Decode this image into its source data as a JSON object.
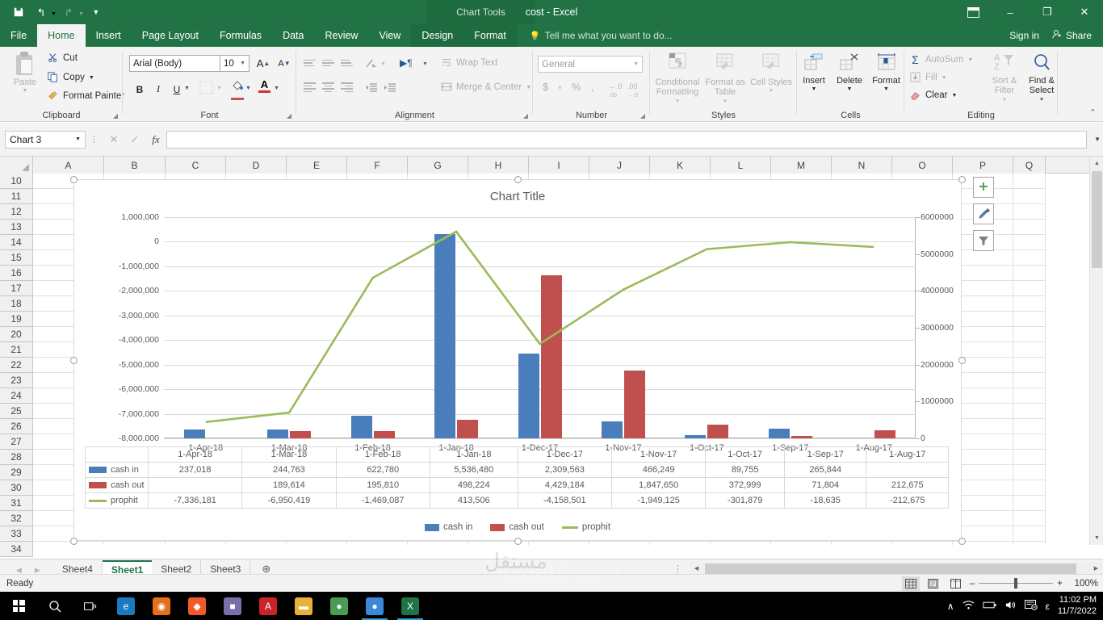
{
  "titlebar": {
    "document_title": "cost - Excel",
    "context_tools": "Chart Tools",
    "save_icon": "save-icon",
    "undo_icon": "undo-icon",
    "redo_icon": "redo-icon",
    "customize_icon": "customize-qat-icon",
    "ribbon_display_icon": "ribbon-display-options-icon",
    "minimize_label": "–",
    "maximize_label": "❐",
    "close_label": "✕"
  },
  "tabs": [
    {
      "label": "File",
      "active": false
    },
    {
      "label": "Home",
      "active": true
    },
    {
      "label": "Insert",
      "active": false
    },
    {
      "label": "Page Layout",
      "active": false
    },
    {
      "label": "Formulas",
      "active": false
    },
    {
      "label": "Data",
      "active": false
    },
    {
      "label": "Review",
      "active": false
    },
    {
      "label": "View",
      "active": false
    }
  ],
  "context_tabs": [
    {
      "label": "Design"
    },
    {
      "label": "Format"
    }
  ],
  "tellme": {
    "placeholder": "Tell me what you want to do...",
    "icon": "lightbulb-icon"
  },
  "account": {
    "sign_in": "Sign in",
    "share": "Share",
    "share_icon": "share-person-icon"
  },
  "ribbon": {
    "groups": [
      "Clipboard",
      "Font",
      "Alignment",
      "Number",
      "Styles",
      "Cells",
      "Editing"
    ],
    "clipboard": {
      "paste": "Paste",
      "cut": "Cut",
      "copy": "Copy",
      "format_painter": "Format Painter"
    },
    "font": {
      "font_name": "Arial (Body)",
      "font_size": "10",
      "grow_font": "A",
      "shrink_font": "A",
      "bold": "B",
      "italic": "I",
      "underline": "U"
    },
    "alignment": {
      "wrap_text": "Wrap Text",
      "merge_center": "Merge & Center"
    },
    "number": {
      "format": "General",
      "currency": "$",
      "percent": "%",
      "comma": ",",
      "increase_decimal": ".00",
      "decrease_decimal": ".00"
    },
    "styles": {
      "conditional_formatting": "Conditional Formatting",
      "format_as_table": "Format as Table",
      "cell_styles": "Cell Styles"
    },
    "cells": {
      "insert": "Insert",
      "delete": "Delete",
      "format": "Format"
    },
    "editing": {
      "autosum": "AutoSum",
      "fill": "Fill",
      "clear": "Clear",
      "sort_filter": "Sort & Filter",
      "find_select": "Find & Select"
    }
  },
  "formulabar": {
    "name_box": "Chart 3",
    "cancel_icon": "cancel-icon",
    "enter_icon": "enter-check-icon",
    "function_icon": "insert-function-icon",
    "formula_value": ""
  },
  "grid": {
    "columns": [
      "A",
      "B",
      "C",
      "D",
      "E",
      "F",
      "G",
      "H",
      "I",
      "J",
      "K",
      "L",
      "M",
      "N",
      "O",
      "P",
      "Q"
    ],
    "rows": [
      10,
      11,
      12,
      13,
      14,
      15,
      16,
      17,
      18,
      19,
      20,
      21,
      22,
      23,
      24,
      25,
      26,
      27,
      28,
      29,
      30,
      31,
      32,
      33,
      34
    ]
  },
  "chart_side_buttons": [
    {
      "name": "chart-elements-button",
      "glyph": "+"
    },
    {
      "name": "chart-styles-button",
      "glyph": "brush"
    },
    {
      "name": "chart-filters-button",
      "glyph": "funnel"
    }
  ],
  "chart_data": {
    "type": "bar",
    "title": "Chart Title",
    "xlabel": "",
    "ylabel": "",
    "categories": [
      "1-Apr-18",
      "1-Mar-18",
      "1-Feb-18",
      "1-Jan-18",
      "1-Dec-17",
      "1-Nov-17",
      "1-Oct-17",
      "1-Sep-17",
      "1-Aug-17"
    ],
    "series": [
      {
        "name": "cash in",
        "color": "#4a7ebb",
        "kind": "bar",
        "axis": "secondary",
        "values": [
          237018,
          244763,
          622780,
          5536480,
          2309563,
          466249,
          89755,
          265844,
          null
        ],
        "labels": [
          "237,018",
          "244,763",
          "622,780",
          "5,536,480",
          "2,309,563",
          "466,249",
          "89,755",
          "265,844",
          ""
        ]
      },
      {
        "name": "cash out",
        "color": "#c0504d",
        "kind": "bar",
        "axis": "secondary",
        "values": [
          null,
          189614,
          195810,
          498224,
          4429184,
          1847650,
          372999,
          71804,
          212675
        ],
        "labels": [
          "",
          "189,614",
          "195,810",
          "498,224",
          "4,429,184",
          "1,847,650",
          "372,999",
          "71,804",
          "212,675"
        ]
      },
      {
        "name": "prophit",
        "color": "#9bbb59",
        "kind": "line",
        "axis": "primary",
        "values": [
          -7336181,
          -6950419,
          -1469087,
          413506,
          -4158501,
          -1949125,
          -301879,
          -18635,
          -212675
        ],
        "labels": [
          "-7,336,181",
          "-6,950,419",
          "-1,469,087",
          "413,506",
          "-4,158,501",
          "-1,949,125",
          "-301,879",
          "-18,635",
          "-212,675"
        ]
      }
    ],
    "primary_axis": {
      "ticks": [
        "1,000,000",
        "0",
        "-1,000,000",
        "-2,000,000",
        "-3,000,000",
        "-4,000,000",
        "-5,000,000",
        "-6,000,000",
        "-7,000,000",
        "-8,000,000"
      ],
      "min": -8000000,
      "max": 1000000
    },
    "secondary_axis": {
      "ticks": [
        "6000000",
        "5000000",
        "4000000",
        "3000000",
        "2000000",
        "1000000",
        "0"
      ],
      "min": 0,
      "max": 6000000
    },
    "grid": true,
    "legend_position": "bottom",
    "data_table_visible": true
  },
  "sheets": [
    {
      "label": "Sheet4",
      "active": false
    },
    {
      "label": "Sheet1",
      "active": true
    },
    {
      "label": "Sheet2",
      "active": false
    },
    {
      "label": "Sheet3",
      "active": false
    }
  ],
  "add_sheet_label": "⊕",
  "statusbar": {
    "state": "Ready",
    "normal_view_icon": "normal-view-icon",
    "page_layout_icon": "page-layout-view-icon",
    "page_break_icon": "page-break-preview-icon",
    "zoom_out": "–",
    "zoom_in": "+",
    "zoom_level": "100%"
  },
  "taskbar": {
    "start_icon": "windows-start-icon",
    "search_icon": "search-icon",
    "taskview_icon": "task-view-icon",
    "apps": [
      {
        "name": "edge-icon",
        "glyph": "e",
        "color": "#1b7bbf",
        "active": false
      },
      {
        "name": "firefox-icon",
        "glyph": "◉",
        "color": "#e4701a",
        "active": false
      },
      {
        "name": "brave-icon",
        "glyph": "◆",
        "color": "#f05a28",
        "active": false
      },
      {
        "name": "app-icon",
        "glyph": "■",
        "color": "#7a6ea8",
        "active": false
      },
      {
        "name": "acrobat-icon",
        "glyph": "A",
        "color": "#cc2229",
        "active": false
      },
      {
        "name": "file-explorer-icon",
        "glyph": "▬",
        "color": "#e8b23a",
        "active": false
      },
      {
        "name": "chrome-icon",
        "glyph": "●",
        "color": "#4a9c54",
        "active": false
      },
      {
        "name": "chrome-2-icon",
        "glyph": "●",
        "color": "#3b87d8",
        "active": true
      },
      {
        "name": "excel-icon",
        "glyph": "X",
        "color": "#217346",
        "active": true
      }
    ],
    "tray": {
      "chevron": "∧",
      "wifi_icon": "wifi-icon",
      "battery_icon": "battery-icon",
      "volume_icon": "volume-icon",
      "notification_icon": "notifications-icon",
      "language": "ε",
      "time": "11:02 PM",
      "date": "11/7/2022"
    }
  },
  "watermark": "mostaql.com"
}
